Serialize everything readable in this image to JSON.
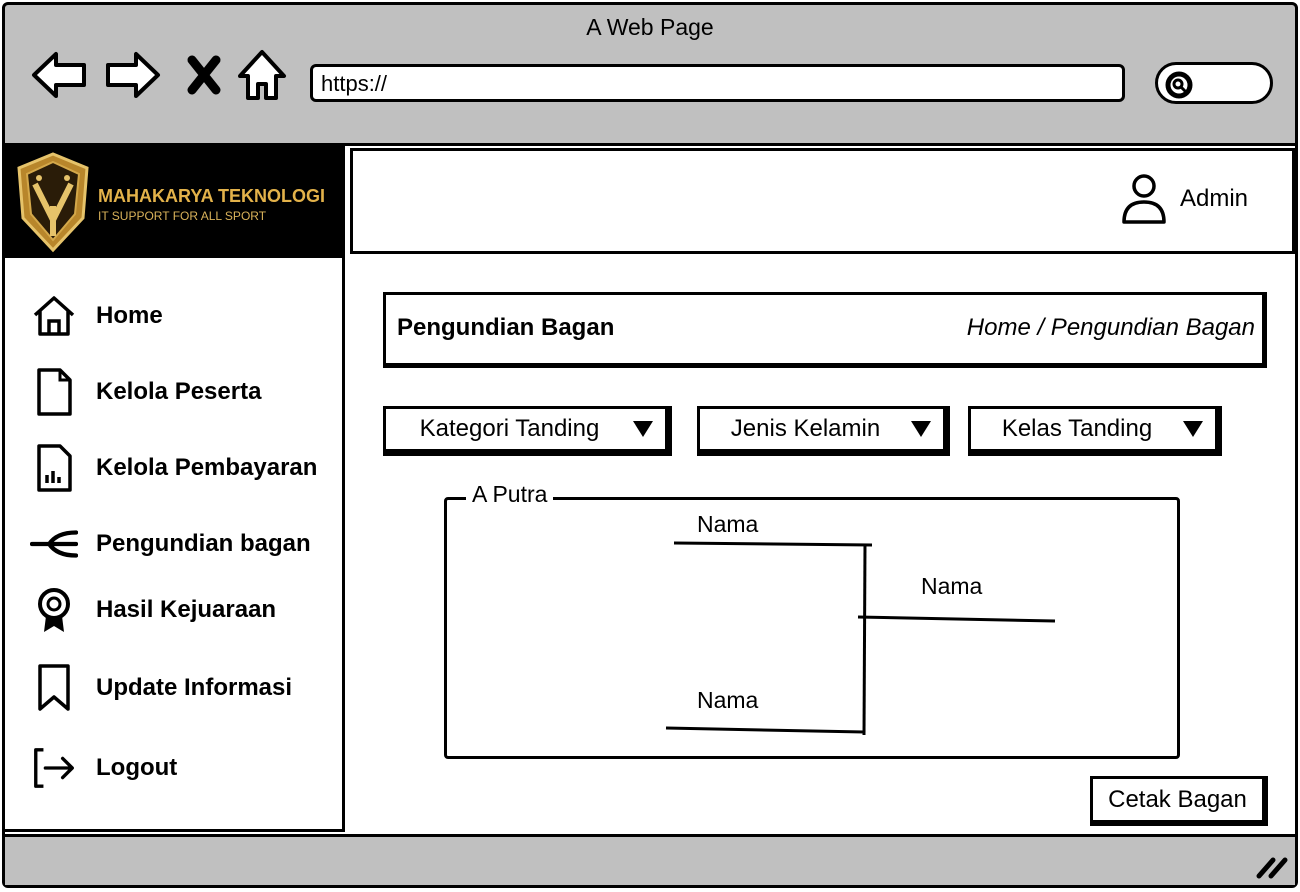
{
  "window": {
    "title": "A Web Page"
  },
  "browser": {
    "url": "https://"
  },
  "brand": {
    "name": "MAHAKARYA TEKNOLOGI",
    "tagline": "IT SUPPORT FOR ALL SPORT"
  },
  "sidebar": {
    "items": [
      {
        "label": "Home",
        "icon": "home-icon"
      },
      {
        "label": "Kelola Peserta",
        "icon": "file-icon"
      },
      {
        "label": "Kelola Pembayaran",
        "icon": "report-file-icon"
      },
      {
        "label": "Pengundian bagan",
        "icon": "merge-arrow-icon"
      },
      {
        "label": "Hasil Kejuaraan",
        "icon": "award-icon"
      },
      {
        "label": "Update Informasi",
        "icon": "bookmark-icon"
      },
      {
        "label": "Logout",
        "icon": "logout-icon"
      }
    ]
  },
  "header": {
    "user": "Admin"
  },
  "page": {
    "title": "Pengundian Bagan",
    "breadcrumb": "Home / Pengundian Bagan"
  },
  "filters": {
    "kategori": "Kategori Tanding",
    "jenis": "Jenis Kelamin",
    "kelas": "Kelas Tanding"
  },
  "bracket": {
    "group": "A Putra",
    "top_name": "Nama",
    "bottom_name": "Nama",
    "winner_name": "Nama"
  },
  "actions": {
    "print_label": "Cetak Bagan"
  }
}
